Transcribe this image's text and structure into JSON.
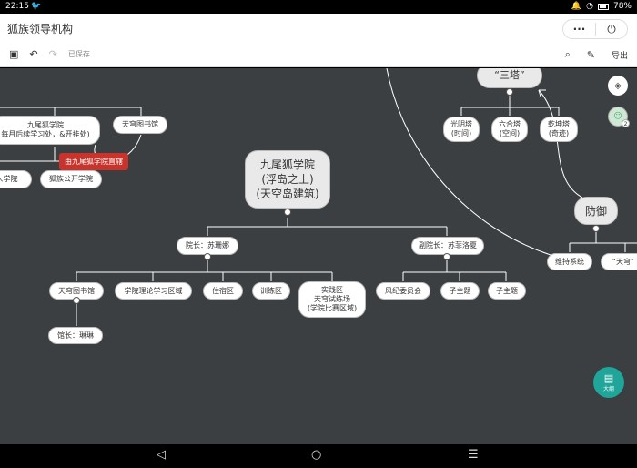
{
  "status": {
    "time": "22:15",
    "notif_icon": "bird-icon",
    "battery": "78%"
  },
  "app": {
    "title": "狐族领导机构",
    "more": "···",
    "power": "⏻"
  },
  "toolbar": {
    "save_status": "已保存",
    "export": "导出"
  },
  "nodes": {
    "academy": [
      "九尾狐学院",
      "(浮岛之上)",
      "(天空岛建筑)"
    ],
    "left_academy": [
      "九尾狐学院",
      "每月后续学习处，&开挂处)"
    ],
    "left_library": "天穹图书馆",
    "left_tag": "由九尾狐学院直辖",
    "left_sub1": "人学院",
    "left_sub2": "狐族公开学院",
    "dean": "院长：苏珊娜",
    "vice_dean": "副院长：苏菲洛夏",
    "library": "天穹图书馆",
    "theory_area": "学院理论学习区域",
    "dorm": "住宿区",
    "training": "训练区",
    "practice": [
      "实践区",
      "天穹试练场",
      "(学院比赛区域)"
    ],
    "librarian": "馆长：琳琳",
    "discipline": "风纪委员会",
    "zi_ying_1": "子主题",
    "zi_ying_2": "子主题",
    "three_towers": "“三塔”",
    "tower_light": [
      "光阴塔",
      "(时间)"
    ],
    "tower_space": [
      "六合塔",
      "(空间)"
    ],
    "tower_fate": [
      "乾坤塔",
      "(奇迹)"
    ],
    "defense": "防御",
    "maintain": "维持系统",
    "tianqiong": "“天穹”"
  },
  "side": {
    "layers_icon": "layers-icon",
    "avatar_badge": "2",
    "fab_label": "大纲"
  },
  "nav": {
    "back": "◁",
    "home": "○",
    "recent": "☰"
  }
}
